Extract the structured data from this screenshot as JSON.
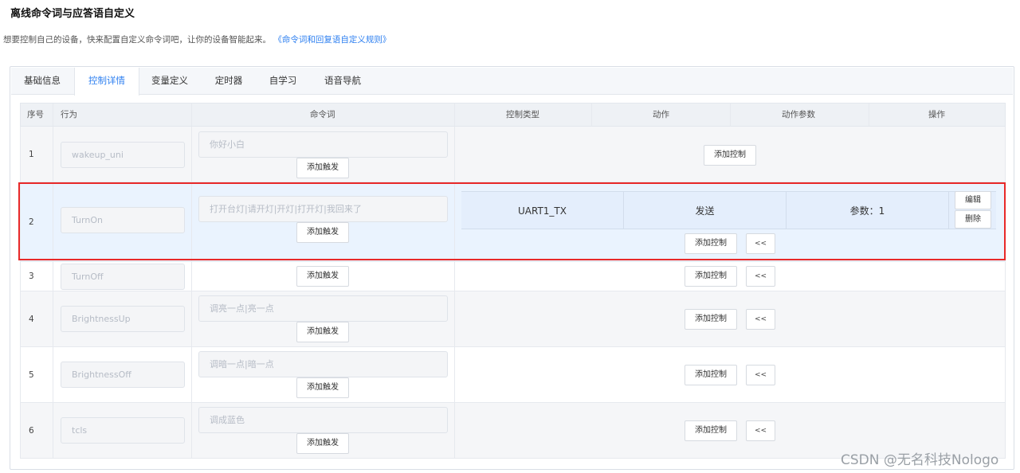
{
  "page": {
    "title": "离线命令词与应答语自定义",
    "description": "想要控制自己的设备，快来配置自定义命令词吧，让你的设备智能起来。",
    "rules_link": "《命令词和回复语自定义规则》"
  },
  "tabs": [
    {
      "label": "基础信息"
    },
    {
      "label": "控制详情"
    },
    {
      "label": "变量定义"
    },
    {
      "label": "定时器"
    },
    {
      "label": "自学习"
    },
    {
      "label": "语音导航"
    }
  ],
  "table": {
    "headers": {
      "index": "序号",
      "behavior": "行为",
      "command": "命令词",
      "control_type": "控制类型",
      "action": "动作",
      "action_params": "动作参数",
      "operation": "操作"
    },
    "rows": [
      {
        "index": "1",
        "behavior": "wakeup_uni",
        "command": "你好小白"
      },
      {
        "index": "2",
        "behavior": "TurnOn",
        "command": "打开台灯|请开灯|开灯|打开灯|我回来了",
        "control": {
          "type": "UART1_TX",
          "action": "发送",
          "params": "参数：1"
        }
      },
      {
        "index": "3",
        "behavior": "TurnOff",
        "command": ""
      },
      {
        "index": "4",
        "behavior": "BrightnessUp",
        "command": "调亮一点|亮一点"
      },
      {
        "index": "5",
        "behavior": "BrightnessOff",
        "command": "调暗一点|暗一点"
      },
      {
        "index": "6",
        "behavior": "tcls",
        "command": "调成蓝色"
      }
    ]
  },
  "buttons": {
    "add_trigger": "添加触发",
    "add_control": "添加控制",
    "collapse": "<<",
    "edit": "编辑",
    "delete": "删除"
  },
  "watermark": "CSDN @无名科技Nologo",
  "colors": {
    "accent": "#2d7ff0",
    "highlight_border": "#e82929",
    "selected_row": "#eaf3fe"
  }
}
